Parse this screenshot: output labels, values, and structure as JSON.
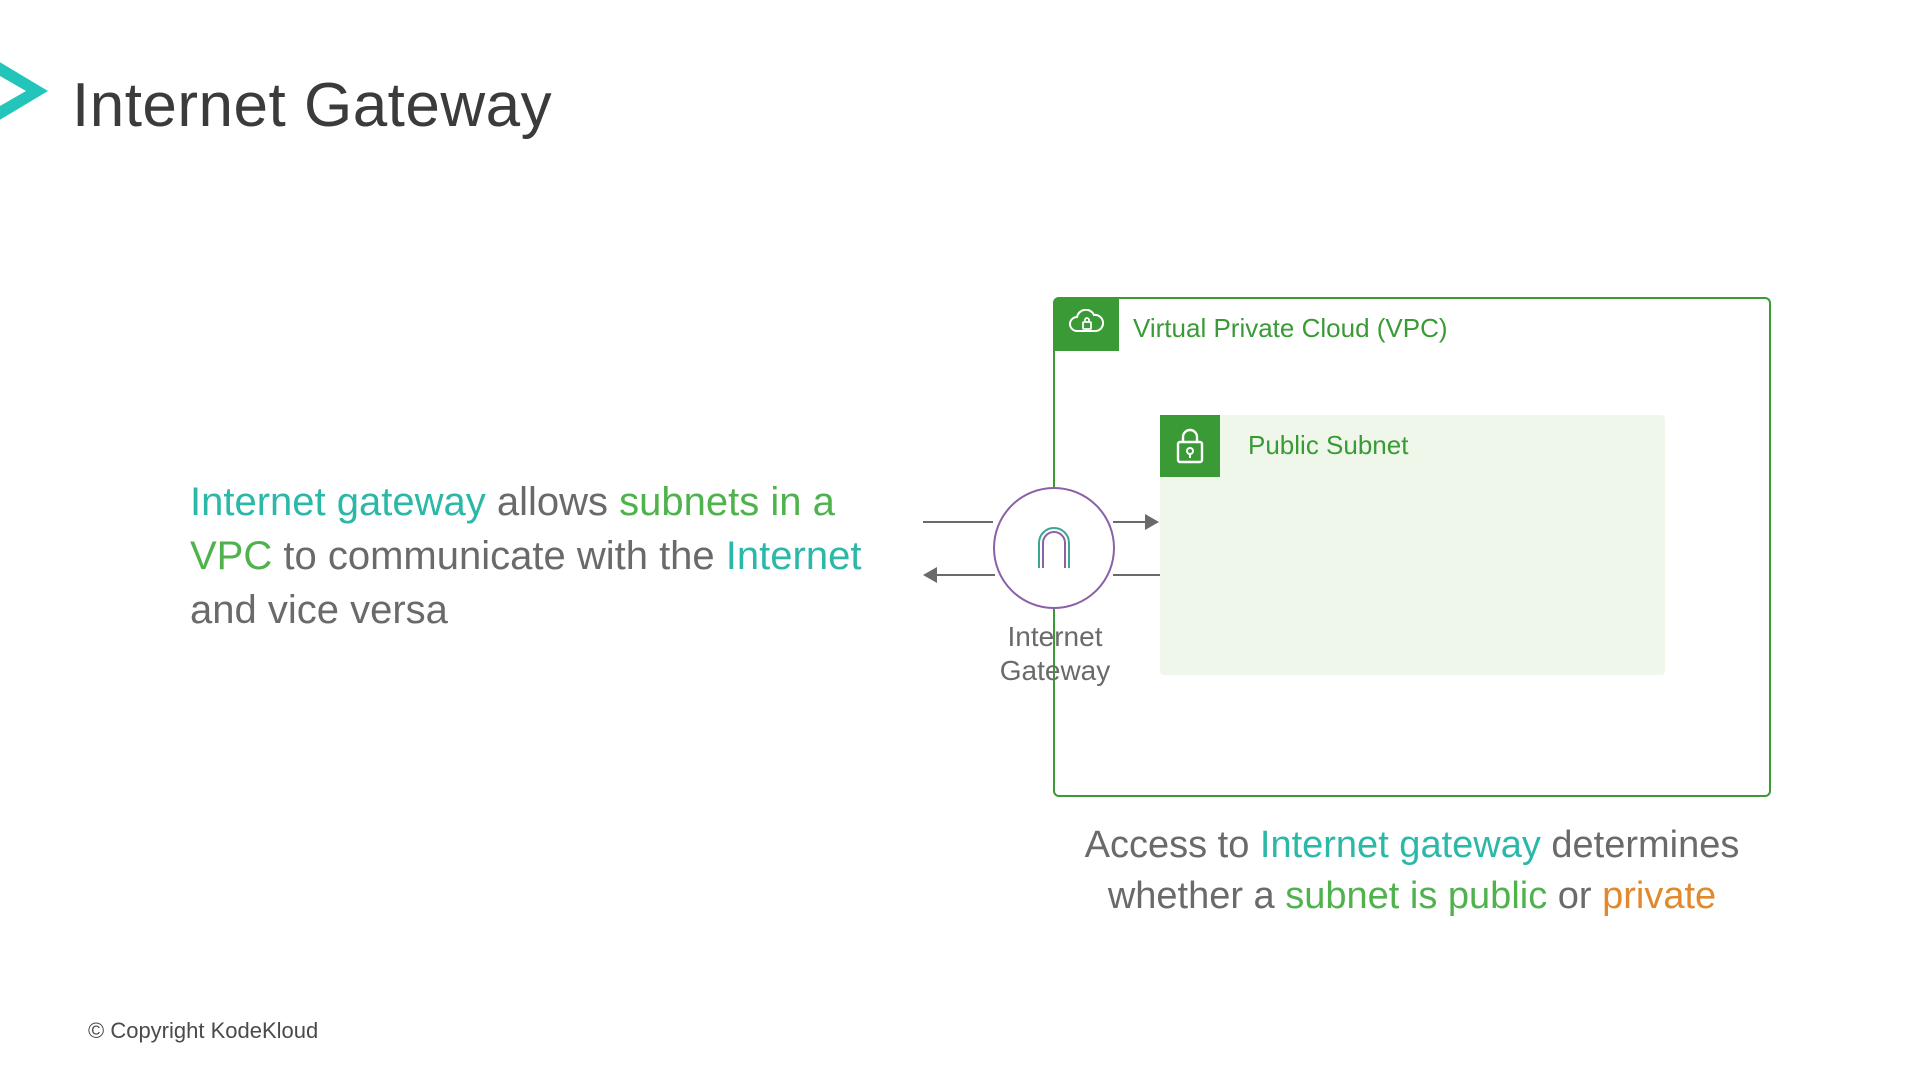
{
  "title": "Internet Gateway",
  "lead": {
    "p1": "Internet gateway",
    "p2": " allows ",
    "p3": "subnets in a VPC",
    "p4": " to communicate with the ",
    "p5": "Internet",
    "p6": " and vice versa"
  },
  "vpc": {
    "label": "Virtual Private Cloud (VPC)"
  },
  "subnet": {
    "label": "Public Subnet"
  },
  "igw": {
    "line1": "Internet",
    "line2": "Gateway"
  },
  "bottom": {
    "p1": "Access to ",
    "p2": "Internet gateway",
    "p3": " determines whether a ",
    "p4": "subnet is public",
    "p5": " or ",
    "p6": "private"
  },
  "copyright": "© Copyright KodeKloud"
}
